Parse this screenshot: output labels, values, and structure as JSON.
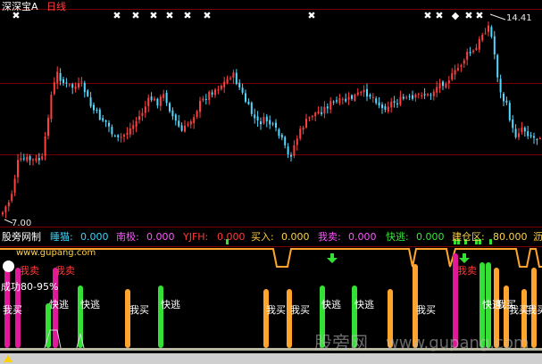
{
  "header": {
    "stock_name": "深深宝A",
    "period": "日线"
  },
  "price_labels": {
    "high": "14.41",
    "low": "7.00"
  },
  "indicator_bar": {
    "name": "股旁网制",
    "items": [
      {
        "label": "睡猫:",
        "value": "0.000",
        "color": "#33d6ff"
      },
      {
        "label": "南极:",
        "value": "0.000",
        "color": "#ff55ff"
      },
      {
        "label": "YJFH:",
        "value": "0.000",
        "color": "#ff3b3b"
      },
      {
        "label": "买入:",
        "value": "0.000",
        "color": "#ffd24a"
      },
      {
        "label": "我卖:",
        "value": "0.000",
        "color": "#ff55ff"
      },
      {
        "label": "快逃:",
        "value": "0.000",
        "color": "#39e639"
      },
      {
        "label": "建仓区:",
        "value": "80.000",
        "color": "#ffd24a"
      },
      {
        "label": "沥",
        "value": "",
        "color": "#ffd24a"
      }
    ]
  },
  "sub_panel": {
    "website": "www.gupang.com",
    "sell_label": "我卖",
    "success_rate": "成功80-95%",
    "buy_label": "我买",
    "escape_label": "快逃"
  },
  "watermark": {
    "cn": "股旁网",
    "url": "www.gupang.com"
  },
  "colors": {
    "up": "#ff4040",
    "down": "#54d8ff",
    "grid": "#7a0000",
    "orange": "#ffa52e",
    "green": "#33e033",
    "magenta": "#e0189a"
  }
}
